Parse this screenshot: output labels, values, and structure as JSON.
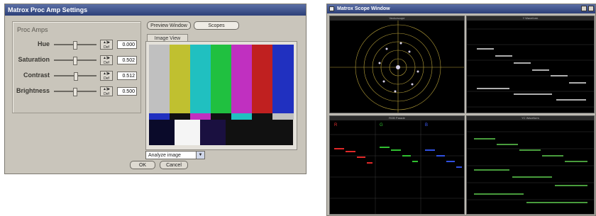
{
  "procamp": {
    "title": "Matrox Proc Amp Settings",
    "group_label": "Proc Amps",
    "controls": [
      {
        "label": "Hue",
        "value": "0.000",
        "level": 0.5
      },
      {
        "label": "Saturation",
        "value": "0.502",
        "level": 0.5
      },
      {
        "label": "Contrast",
        "value": "0.512",
        "level": 0.51
      },
      {
        "label": "Brightness",
        "value": "0.500",
        "level": 0.5
      }
    ],
    "spin_top": "▲|▶",
    "spin_bottom": "Def",
    "preview_button": "Preview Window",
    "scopes_button": "Scopes",
    "image_view_tab": "Image View",
    "analyze_option": "Analyze image",
    "ok_button": "OK",
    "cancel_button": "Cancel",
    "bar_colors": [
      "#c0c0c0",
      "#c0c030",
      "#20c0c0",
      "#20c040",
      "#c030c0",
      "#c02020",
      "#2030c0"
    ],
    "mid_colors": [
      "#2030c0",
      "#111111",
      "#c030c0",
      "#111111",
      "#20c0c0",
      "#111111",
      "#c0c0c0"
    ],
    "bottom_colors": [
      "#0a0a2a",
      "#f5f5f5",
      "#1a1040",
      "#111111",
      "#111111"
    ]
  },
  "scope": {
    "title": "Matrox Scope Window",
    "panes": {
      "vectorscope": "Vectorscope",
      "y_waveform": "Y Waveform",
      "rgb_parade": "RGB Parade",
      "yc_waveform": "YC Waveform"
    },
    "parade_labels": [
      "R",
      "G",
      "B"
    ]
  }
}
